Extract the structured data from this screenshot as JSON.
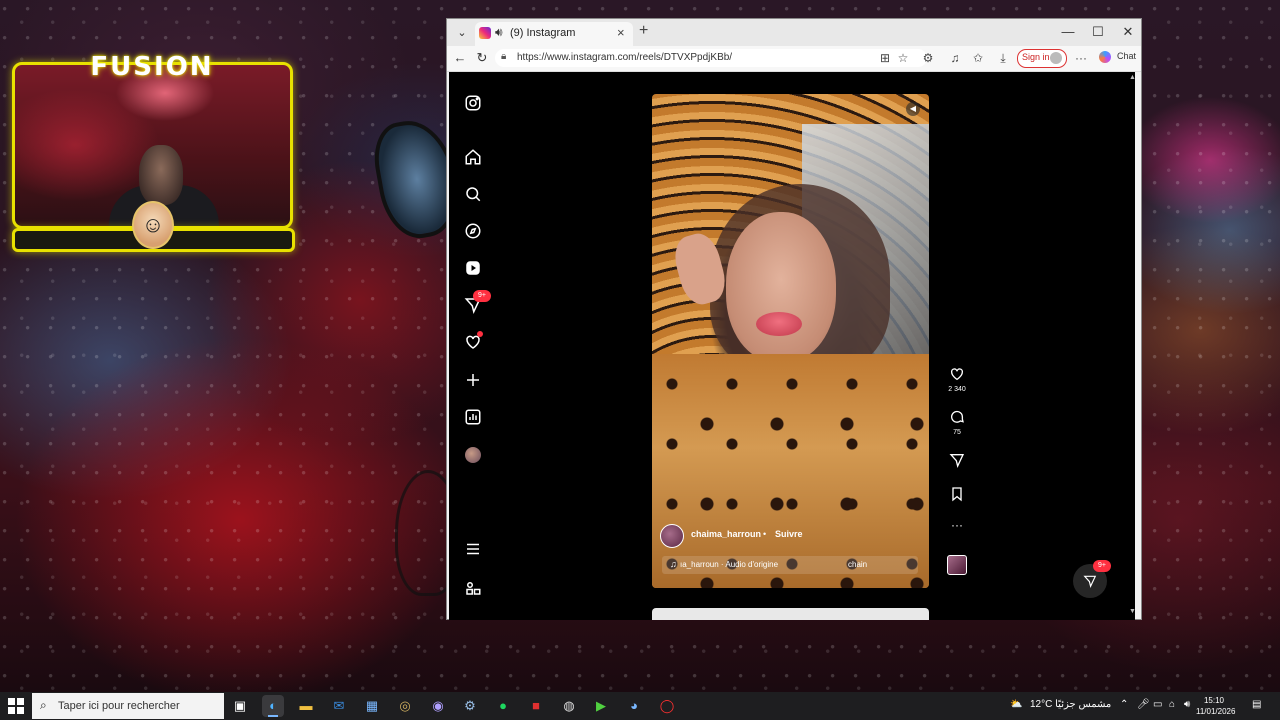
{
  "stream_overlay": {
    "logo": "FUSION"
  },
  "browser": {
    "tab": {
      "title": "(9) Instagram"
    },
    "url": "https://www.instagram.com/reels/DTVXPpdjKBb/",
    "signin_label": "Sign in",
    "chat_label": "Chat"
  },
  "instagram": {
    "sidebar": {
      "messages_badge": "9+"
    },
    "reel": {
      "username": "chaima_harroun",
      "dot": "•",
      "follow_label": "Suivre",
      "audio_text": "ıa_harroun · Audio d'origine",
      "audio_side": "chain"
    },
    "actions": {
      "likes": "2 340",
      "comments": "75"
    },
    "messages_float_badge": "9+"
  },
  "taskbar": {
    "search_placeholder": "Taper ici pour rechercher",
    "weather": "12°C  مشمس جزئيًا",
    "time": "15:10",
    "date": "11/01/2026"
  },
  "colors": {
    "stream_accent": "#e8e100",
    "badge": "#ff3040",
    "signin_border": "#dd3333"
  }
}
